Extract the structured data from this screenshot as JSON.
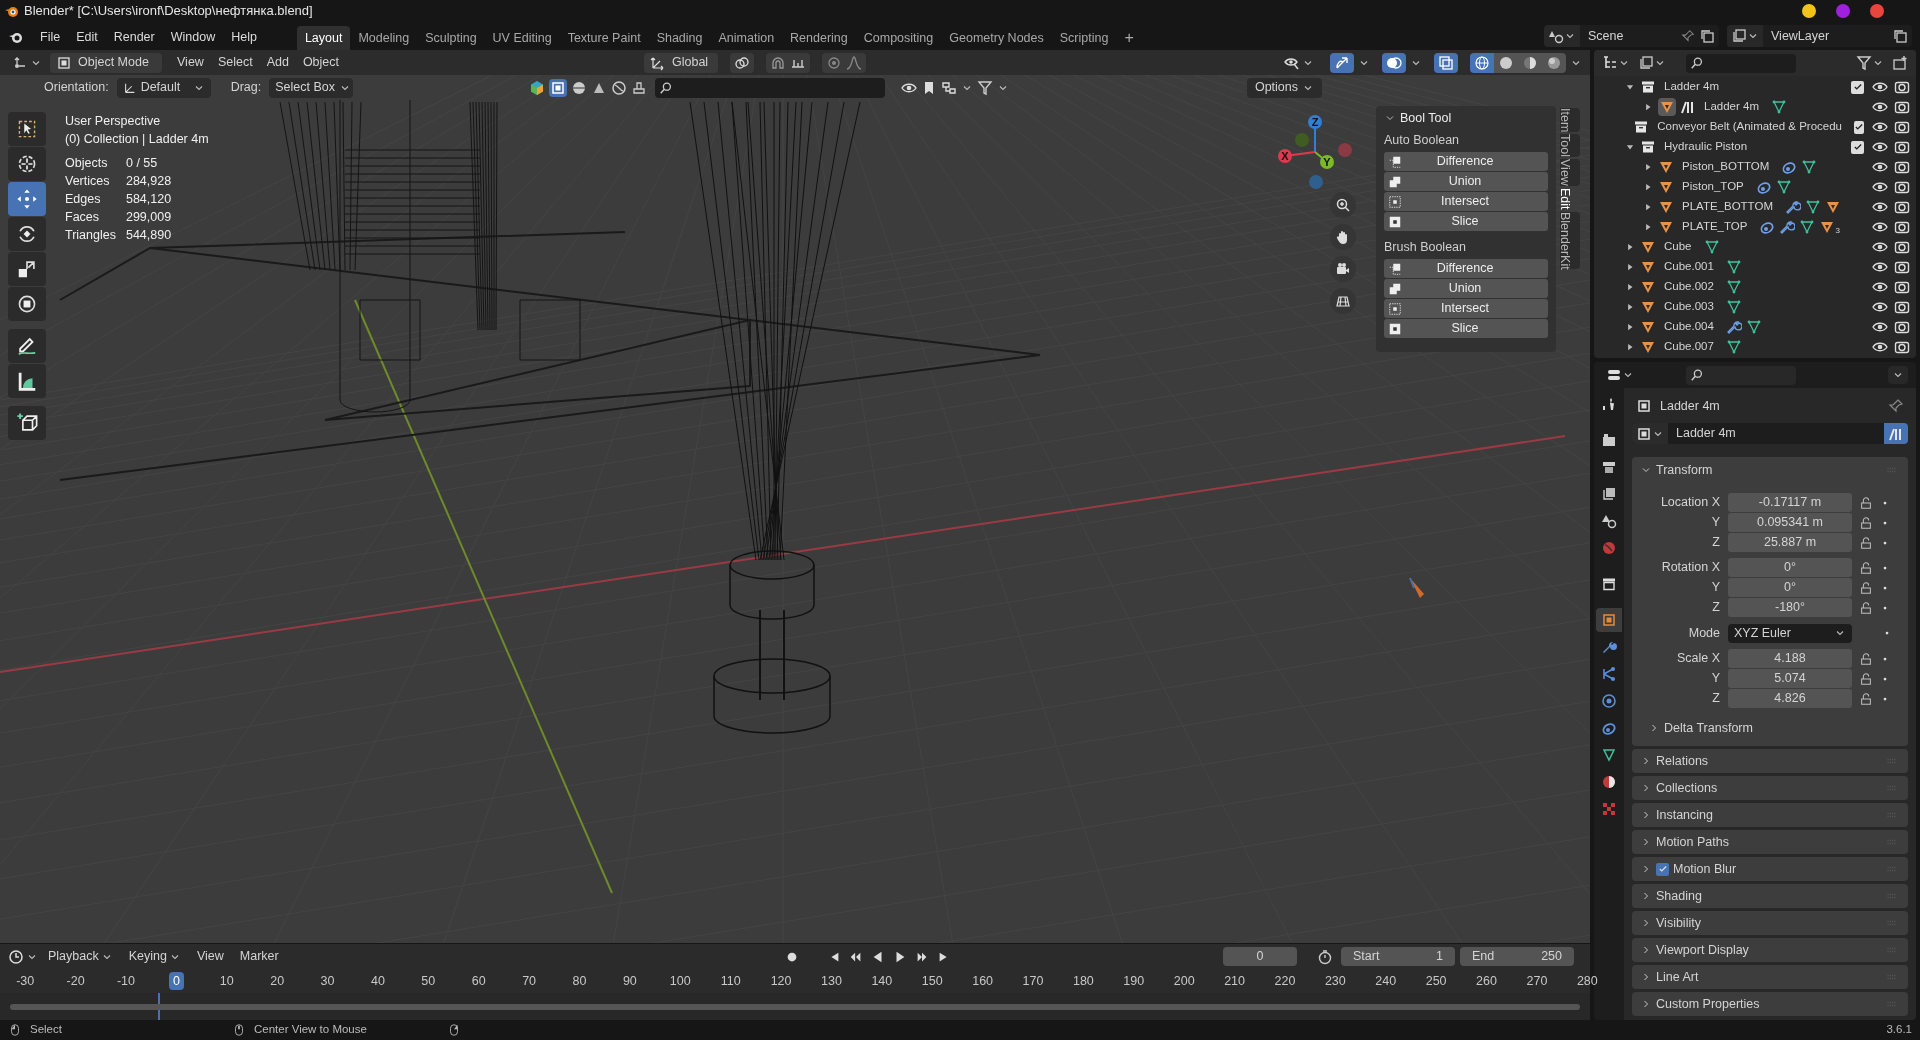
{
  "window": {
    "title": "Blender* [C:\\Users\\ironf\\Desktop\\нефтянка.blend]"
  },
  "window_controls": [
    {
      "color": "#f2c417"
    },
    {
      "color": "#a020e0"
    },
    {
      "color": "#e8463c"
    }
  ],
  "menu": [
    "File",
    "Edit",
    "Render",
    "Window",
    "Help"
  ],
  "workspaces": [
    {
      "label": "Layout",
      "selected": true
    },
    {
      "label": "Modeling",
      "selected": false
    },
    {
      "label": "Sculpting",
      "selected": false
    },
    {
      "label": "UV Editing",
      "selected": false
    },
    {
      "label": "Texture Paint",
      "selected": false
    },
    {
      "label": "Shading",
      "selected": false
    },
    {
      "label": "Animation",
      "selected": false
    },
    {
      "label": "Rendering",
      "selected": false
    },
    {
      "label": "Compositing",
      "selected": false
    },
    {
      "label": "Geometry Nodes",
      "selected": false
    },
    {
      "label": "Scripting",
      "selected": false
    }
  ],
  "add_workspace": "+",
  "scene": "Scene",
  "view_layer": "ViewLayer",
  "viewport_header": {
    "mode": "Object Mode",
    "menus": [
      "View",
      "Select",
      "Add",
      "Object"
    ],
    "transform_orientation": "Global"
  },
  "tool_settings": {
    "orientation_label": "Orientation:",
    "orientation": "Default",
    "drag_label": "Drag:",
    "drag": "Select Box",
    "options": "Options"
  },
  "toolbar": [
    {
      "kind": "select_box",
      "selected": false
    },
    {
      "kind": "cursor",
      "selected": false
    },
    {
      "kind": "move",
      "selected": true
    },
    {
      "kind": "rotate",
      "selected": false
    },
    {
      "kind": "scale",
      "selected": false
    },
    {
      "kind": "transform",
      "selected": false
    },
    {
      "kind": "annotate",
      "selected": false
    },
    {
      "kind": "measure",
      "selected": false
    },
    {
      "kind": "add_cube",
      "selected": false
    }
  ],
  "viewport_info": {
    "view_name": "User Perspective",
    "collection": "(0) Collection | Ladder 4m",
    "stats": [
      {
        "label": "Objects",
        "value": "0 / 55"
      },
      {
        "label": "Vertices",
        "value": "284,928"
      },
      {
        "label": "Edges",
        "value": "584,120"
      },
      {
        "label": "Faces",
        "value": "299,009"
      },
      {
        "label": "Triangles",
        "value": "544,890"
      }
    ]
  },
  "nav_gizmo": {
    "axes": [
      {
        "label": "Z",
        "color": "#2f7fd6"
      },
      {
        "label": "Y",
        "color": "#7bb82a"
      },
      {
        "label": "X",
        "color": "#e0394f"
      }
    ]
  },
  "bool_tool": {
    "title": "Bool Tool",
    "expanded": true,
    "sections": [
      {
        "title": "Auto Boolean",
        "buttons": [
          {
            "kind": "difference",
            "label": "Difference"
          },
          {
            "kind": "union",
            "label": "Union"
          },
          {
            "kind": "intersect",
            "label": "Intersect"
          },
          {
            "kind": "slice",
            "label": "Slice"
          }
        ]
      },
      {
        "title": "Brush Boolean",
        "buttons": [
          {
            "kind": "difference",
            "label": "Difference"
          },
          {
            "kind": "union",
            "label": "Union"
          },
          {
            "kind": "intersect",
            "label": "Intersect"
          },
          {
            "kind": "slice",
            "label": "Slice"
          }
        ]
      }
    ]
  },
  "sidebar_tabs": [
    {
      "label": "Item",
      "selected": false
    },
    {
      "label": "Tool",
      "selected": false
    },
    {
      "label": "View",
      "selected": false
    },
    {
      "label": "Edit",
      "selected": true
    },
    {
      "label": "BlenderKit",
      "selected": false
    }
  ],
  "outliner": {
    "items": [
      {
        "name": "Ladder 4m",
        "kind": "collection",
        "expanded": true,
        "checked": true,
        "children": [
          {
            "name": "Ladder 4m",
            "kind": "object",
            "active": true,
            "linked": true,
            "expanded": false,
            "badges": [
              {
                "kind": "mesh"
              }
            ]
          }
        ]
      },
      {
        "name": "Conveyor Belt (Animated & Procedu",
        "kind": "collection",
        "checked": true
      },
      {
        "name": "Hydraulic Piston",
        "kind": "collection",
        "expanded": true,
        "checked": true,
        "children": [
          {
            "name": "Piston_BOTTOM",
            "kind": "object",
            "expanded": false,
            "badges": [
              {
                "kind": "constraint"
              },
              {
                "kind": "mesh"
              }
            ]
          },
          {
            "name": "Piston_TOP",
            "kind": "object",
            "expanded": false,
            "badges": [
              {
                "kind": "constraint"
              },
              {
                "kind": "mesh"
              }
            ]
          },
          {
            "name": "PLATE_BOTTOM",
            "kind": "object",
            "expanded": false,
            "badges": [
              {
                "kind": "modifier"
              },
              {
                "kind": "mesh"
              },
              {
                "kind": "object"
              }
            ]
          },
          {
            "name": "PLATE_TOP",
            "kind": "object",
            "expanded": false,
            "badges": [
              {
                "kind": "constraint"
              },
              {
                "kind": "modifier"
              },
              {
                "kind": "mesh"
              },
              {
                "kind": "object",
                "count": "3"
              }
            ]
          }
        ]
      },
      {
        "name": "Cube",
        "kind": "object",
        "expanded": false,
        "badges": [
          {
            "kind": "mesh"
          }
        ]
      },
      {
        "name": "Cube.001",
        "kind": "object",
        "expanded": false,
        "badges": [
          {
            "kind": "mesh"
          }
        ]
      },
      {
        "name": "Cube.002",
        "kind": "object",
        "expanded": false,
        "badges": [
          {
            "kind": "mesh"
          }
        ]
      },
      {
        "name": "Cube.003",
        "kind": "object",
        "expanded": false,
        "badges": [
          {
            "kind": "mesh"
          }
        ]
      },
      {
        "name": "Cube.004",
        "kind": "object",
        "expanded": false,
        "badges": [
          {
            "kind": "modifier"
          },
          {
            "kind": "mesh"
          }
        ]
      },
      {
        "name": "Cube.007",
        "kind": "object",
        "expanded": false,
        "badges": [
          {
            "kind": "mesh"
          }
        ]
      }
    ]
  },
  "properties": {
    "tabs": [
      {
        "kind": "tool",
        "selected": false
      },
      {
        "kind": "render",
        "selected": false
      },
      {
        "kind": "output",
        "selected": false
      },
      {
        "kind": "view_layer",
        "selected": false
      },
      {
        "kind": "scene",
        "selected": false
      },
      {
        "kind": "world",
        "selected": false
      },
      {
        "kind": "collection",
        "selected": false
      },
      {
        "kind": "object",
        "selected": true
      },
      {
        "kind": "modifiers",
        "selected": false
      },
      {
        "kind": "particles",
        "selected": false
      },
      {
        "kind": "physics",
        "selected": false
      },
      {
        "kind": "constraints",
        "selected": false
      },
      {
        "kind": "data",
        "selected": false
      },
      {
        "kind": "material",
        "selected": false
      },
      {
        "kind": "texture",
        "selected": false
      }
    ],
    "object_name": "Ladder 4m",
    "datablock": "Ladder 4m",
    "transform": {
      "title": "Transform",
      "expanded": true,
      "groups": [
        [
          {
            "label": "Location X",
            "value": "-0.17117 m"
          },
          {
            "label": "Y",
            "value": "0.095341 m"
          },
          {
            "label": "Z",
            "value": "25.887 m"
          }
        ],
        [
          {
            "label": "Rotation X",
            "value": "0°"
          },
          {
            "label": "Y",
            "value": "0°"
          },
          {
            "label": "Z",
            "value": "-180°"
          }
        ],
        [
          {
            "label": "Mode",
            "value": "XYZ Euler",
            "kind": "dropdown"
          }
        ],
        [
          {
            "label": "Scale X",
            "value": "4.188"
          },
          {
            "label": "Y",
            "value": "5.074"
          },
          {
            "label": "Z",
            "value": "4.826"
          }
        ]
      ],
      "subpanel": "Delta Transform"
    },
    "panels": [
      {
        "label": "Relations"
      },
      {
        "label": "Collections"
      },
      {
        "label": "Instancing"
      },
      {
        "label": "Motion Paths"
      },
      {
        "label": "Motion Blur",
        "checked": true
      },
      {
        "label": "Shading"
      },
      {
        "label": "Visibility"
      },
      {
        "label": "Viewport Display"
      },
      {
        "label": "Line Art"
      },
      {
        "label": "Custom Properties"
      }
    ]
  },
  "timeline": {
    "menus": [
      "Playback",
      "Keying",
      "View",
      "Marker"
    ],
    "current_frame": "0",
    "start_label": "Start",
    "start": "1",
    "end_label": "End",
    "end": "250",
    "ticks": [
      {
        "label": "-30",
        "selected": false
      },
      {
        "label": "-20",
        "selected": false
      },
      {
        "label": "-10",
        "selected": false
      },
      {
        "label": "0",
        "selected": true
      },
      {
        "label": "10",
        "selected": false
      },
      {
        "label": "20",
        "selected": false
      },
      {
        "label": "30",
        "selected": false
      },
      {
        "label": "40",
        "selected": false
      },
      {
        "label": "50",
        "selected": false
      },
      {
        "label": "60",
        "selected": false
      },
      {
        "label": "70",
        "selected": false
      },
      {
        "label": "80",
        "selected": false
      },
      {
        "label": "90",
        "selected": false
      },
      {
        "label": "100",
        "selected": false
      },
      {
        "label": "110",
        "selected": false
      },
      {
        "label": "120",
        "selected": false
      },
      {
        "label": "130",
        "selected": false
      },
      {
        "label": "140",
        "selected": false
      },
      {
        "label": "150",
        "selected": false
      },
      {
        "label": "160",
        "selected": false
      },
      {
        "label": "170",
        "selected": false
      },
      {
        "label": "180",
        "selected": false
      },
      {
        "label": "190",
        "selected": false
      },
      {
        "label": "200",
        "selected": false
      },
      {
        "label": "210",
        "selected": false
      },
      {
        "label": "220",
        "selected": false
      },
      {
        "label": "230",
        "selected": false
      },
      {
        "label": "240",
        "selected": false
      },
      {
        "label": "250",
        "selected": false
      },
      {
        "label": "260",
        "selected": false
      },
      {
        "label": "270",
        "selected": false
      },
      {
        "label": "280",
        "selected": false
      }
    ]
  },
  "status_bar": {
    "left": "Select",
    "middle": "Center View to Mouse",
    "version": "3.6.1"
  }
}
